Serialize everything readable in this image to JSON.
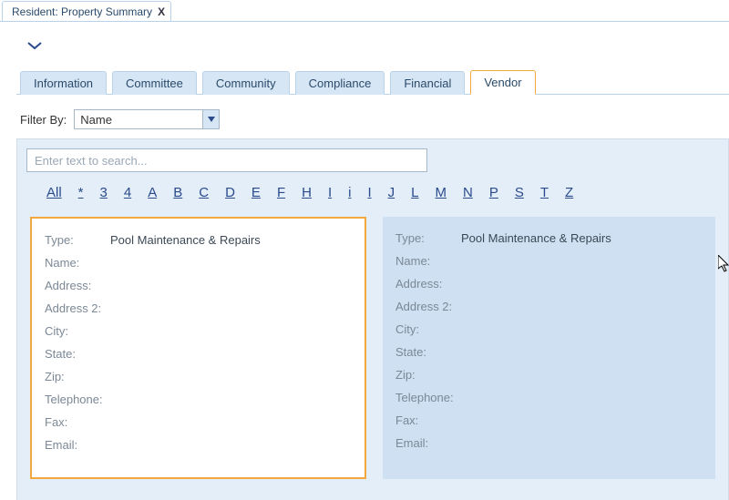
{
  "docTab": {
    "title": "Resident: Property Summary",
    "close": "X"
  },
  "tabs": {
    "information": "Information",
    "committee": "Committee",
    "community": "Community",
    "compliance": "Compliance",
    "financial": "Financial",
    "vendor": "Vendor"
  },
  "filter": {
    "label": "Filter By:",
    "selected": "Name"
  },
  "search": {
    "placeholder": "Enter text to search..."
  },
  "alpha": [
    "All",
    "*",
    "3",
    "4",
    "A",
    "B",
    "C",
    "D",
    "E",
    "F",
    "H",
    "I",
    "i",
    "I",
    "J",
    "L",
    "M",
    "N",
    "P",
    "S",
    "T",
    "Z"
  ],
  "fieldLabels": {
    "type": "Type:",
    "name": "Name:",
    "address": "Address:",
    "address2": "Address 2:",
    "city": "City:",
    "state": "State:",
    "zip": "Zip:",
    "telephone": "Telephone:",
    "fax": "Fax:",
    "email": "Email:"
  },
  "cards": [
    {
      "type": "Pool Maintenance & Repairs",
      "name": "",
      "address": "",
      "address2": "",
      "city": "",
      "state": "",
      "zip": "",
      "telephone": "",
      "fax": "",
      "email": ""
    },
    {
      "type": "Pool Maintenance & Repairs",
      "name": "",
      "address": "",
      "address2": "",
      "city": "",
      "state": "",
      "zip": "",
      "telephone": "",
      "fax": "",
      "email": ""
    }
  ]
}
